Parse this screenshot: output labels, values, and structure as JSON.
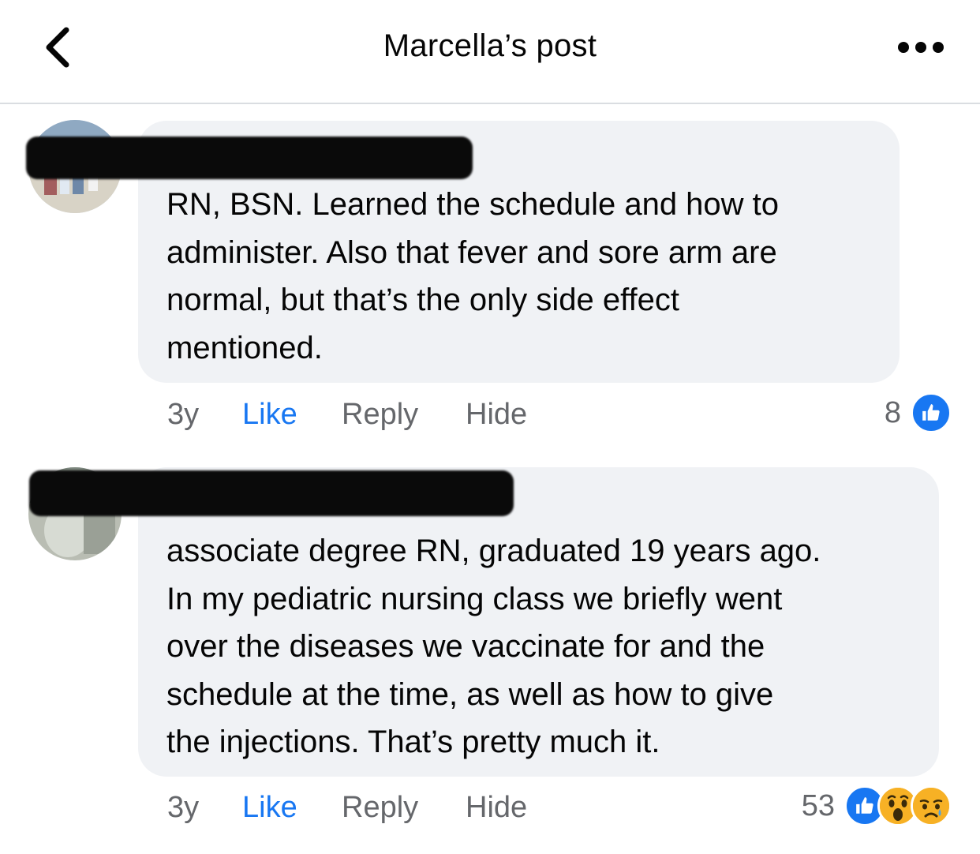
{
  "header": {
    "title": "Marcella’s post"
  },
  "comments": [
    {
      "text": "RN, BSN. Learned the schedule and how to\nadminister. Also that fever and sore arm are\nnormal, but that’s the only side effect\nmentioned.",
      "time": "3y",
      "like_label": "Like",
      "reply_label": "Reply",
      "hide_label": "Hide",
      "reaction_count": "8",
      "reactions": [
        "like-icon"
      ]
    },
    {
      "text": "associate degree RN, graduated 19 years ago.\nIn my pediatric nursing class we briefly went\nover the diseases we vaccinate for and the\nschedule at the time, as well as how to give\nthe injections. That’s pretty much it.",
      "time": "3y",
      "like_label": "Like",
      "reply_label": "Reply",
      "hide_label": "Hide",
      "reaction_count": "53",
      "reactions": [
        "like-icon",
        "wow-icon",
        "sad-icon"
      ]
    }
  ],
  "colors": {
    "accent": "#1877f2",
    "bubble": "#f0f2f5",
    "secondary_text": "#65676b",
    "reaction_yellow": "#f7b125"
  }
}
